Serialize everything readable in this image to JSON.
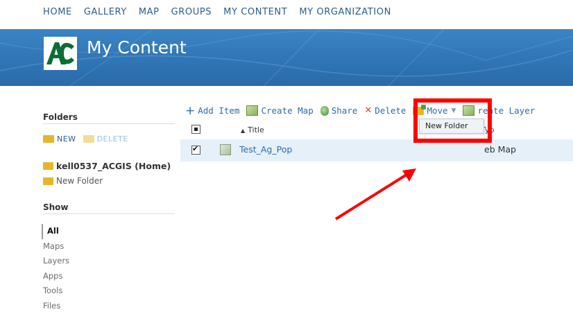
{
  "nav": {
    "items": [
      "HOME",
      "GALLERY",
      "MAP",
      "GROUPS",
      "MY CONTENT",
      "MY ORGANIZATION"
    ]
  },
  "banner": {
    "title": "My Content",
    "color": "#2f74b5"
  },
  "folders": {
    "heading": "Folders",
    "new_label": "NEW",
    "delete_label": "DELETE",
    "items": [
      {
        "label": "kell0537_ACGIS (Home)"
      },
      {
        "label": "New Folder"
      }
    ]
  },
  "show": {
    "heading": "Show",
    "items": [
      "All",
      "Maps",
      "Layers",
      "Apps",
      "Tools",
      "Files"
    ],
    "active": "All"
  },
  "toolbar": {
    "add_item": "Add Item",
    "create_map": "Create Map",
    "share": "Share",
    "delete": "Delete",
    "move": "Move",
    "create_layer": "Create Layer",
    "create_layer_visible": "reate Layer"
  },
  "table": {
    "col_title": "Title",
    "col_type": "Typ",
    "rows": [
      {
        "title": "Test_Ag_Pop",
        "type": "Web Map",
        "type_visible": "eb Map",
        "checked": true
      }
    ]
  },
  "move_dropdown": {
    "items": [
      "New Folder"
    ]
  },
  "annotation": {
    "highlight_color": "#ff0000"
  }
}
